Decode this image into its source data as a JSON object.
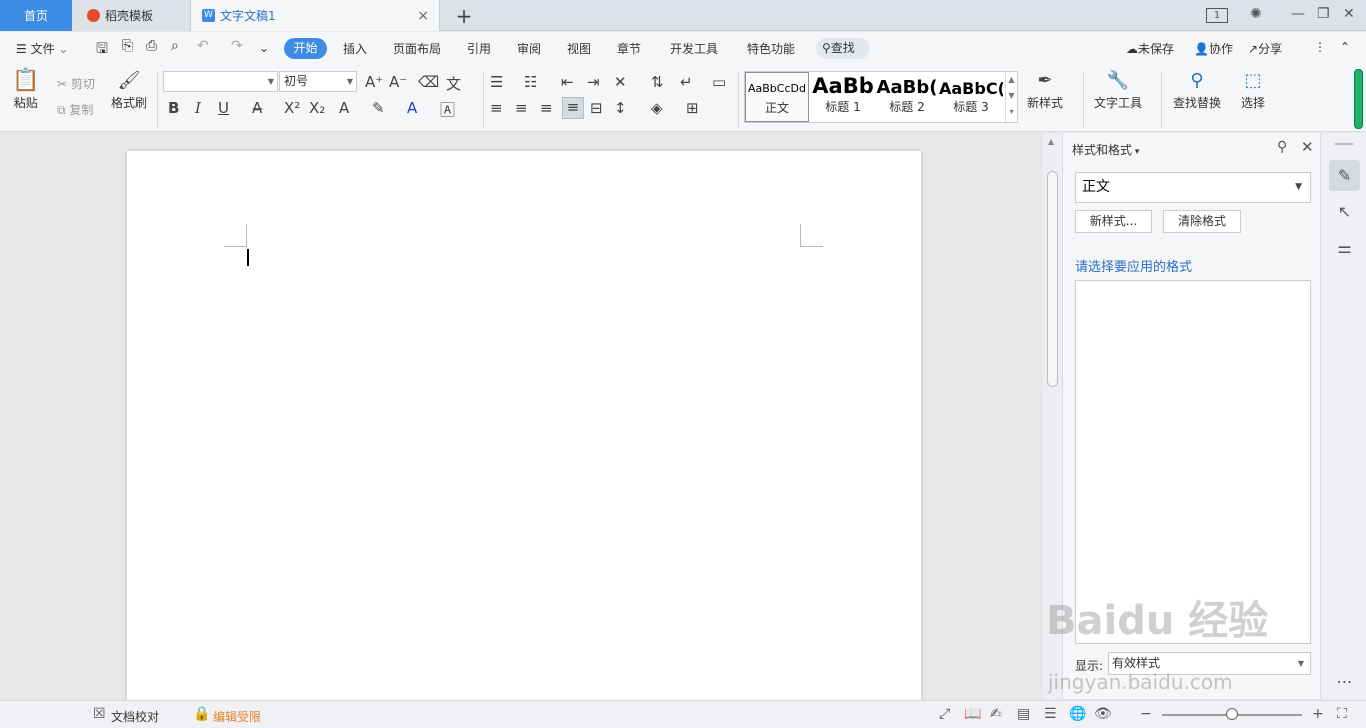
{
  "tabs": {
    "home": "首页",
    "template": "稻壳模板",
    "doc": "文字文稿1",
    "doc_icon": "W",
    "close": "×",
    "add": "+"
  },
  "window": {
    "page_indicator": "1",
    "min": "—",
    "restore": "❐",
    "close": "✕"
  },
  "menu": {
    "file": "文件",
    "start": "开始",
    "insert": "插入",
    "layout": "页面布局",
    "refs": "引用",
    "review": "审阅",
    "view": "视图",
    "chapter": "章节",
    "dev": "开发工具",
    "special": "特色功能",
    "search": "查找",
    "unsaved": "未保存",
    "collab": "协作",
    "share": "分享"
  },
  "ribbon": {
    "paste": "粘贴",
    "cut": "剪切",
    "copy": "复制",
    "format_painter": "格式刷",
    "font_name": "",
    "font_size": "初号",
    "bold": "B",
    "italic": "I",
    "underline": "U",
    "styles": [
      {
        "preview": "AaBbCcDd",
        "label": "正文"
      },
      {
        "preview": "AaBb",
        "label": "标题 1"
      },
      {
        "preview": "AaBb(",
        "label": "标题 2"
      },
      {
        "preview": "AaBbC(",
        "label": "标题 3"
      }
    ],
    "new_style": "新样式",
    "text_tools": "文字工具",
    "find_replace": "查找替换",
    "select": "选择"
  },
  "panel": {
    "title": "样式和格式",
    "current_style": "正文",
    "new_style_btn": "新样式...",
    "clear_btn": "清除格式",
    "hint": "请选择要应用的格式",
    "show_label": "显示:",
    "show_value": "有效样式"
  },
  "status": {
    "proofread": "文档校对",
    "restricted": "编辑受限"
  },
  "watermark": {
    "main": "Baidu 经验",
    "sub": "jingyan.baidu.com"
  },
  "colors": {
    "accent": "#3c8ce4",
    "link": "#2b6cc4",
    "warning": "#e67e22",
    "green": "#1db36a"
  }
}
